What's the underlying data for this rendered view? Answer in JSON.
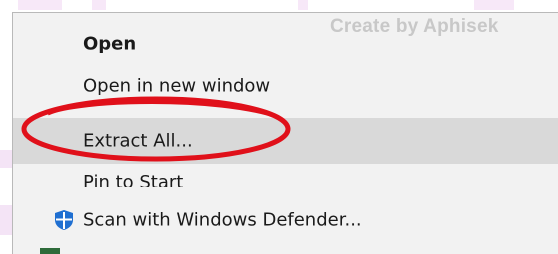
{
  "watermark": "Create by Aphisek",
  "menu": {
    "items": [
      {
        "label": "Open",
        "bold": true
      },
      {
        "label": "Open in new window"
      },
      {
        "label": "Extract All...",
        "highlighted": true,
        "annotated": "red-oval"
      },
      {
        "label": "Pin to Start"
      },
      {
        "label": "Scan with Windows Defender...",
        "icon": "windows-defender-shield-icon"
      }
    ]
  },
  "colors": {
    "menu_bg": "#f2f2f2",
    "hover_bg": "#d9d9d9",
    "annotation": "#e0101a",
    "defender_blue": "#1f6fd1"
  }
}
